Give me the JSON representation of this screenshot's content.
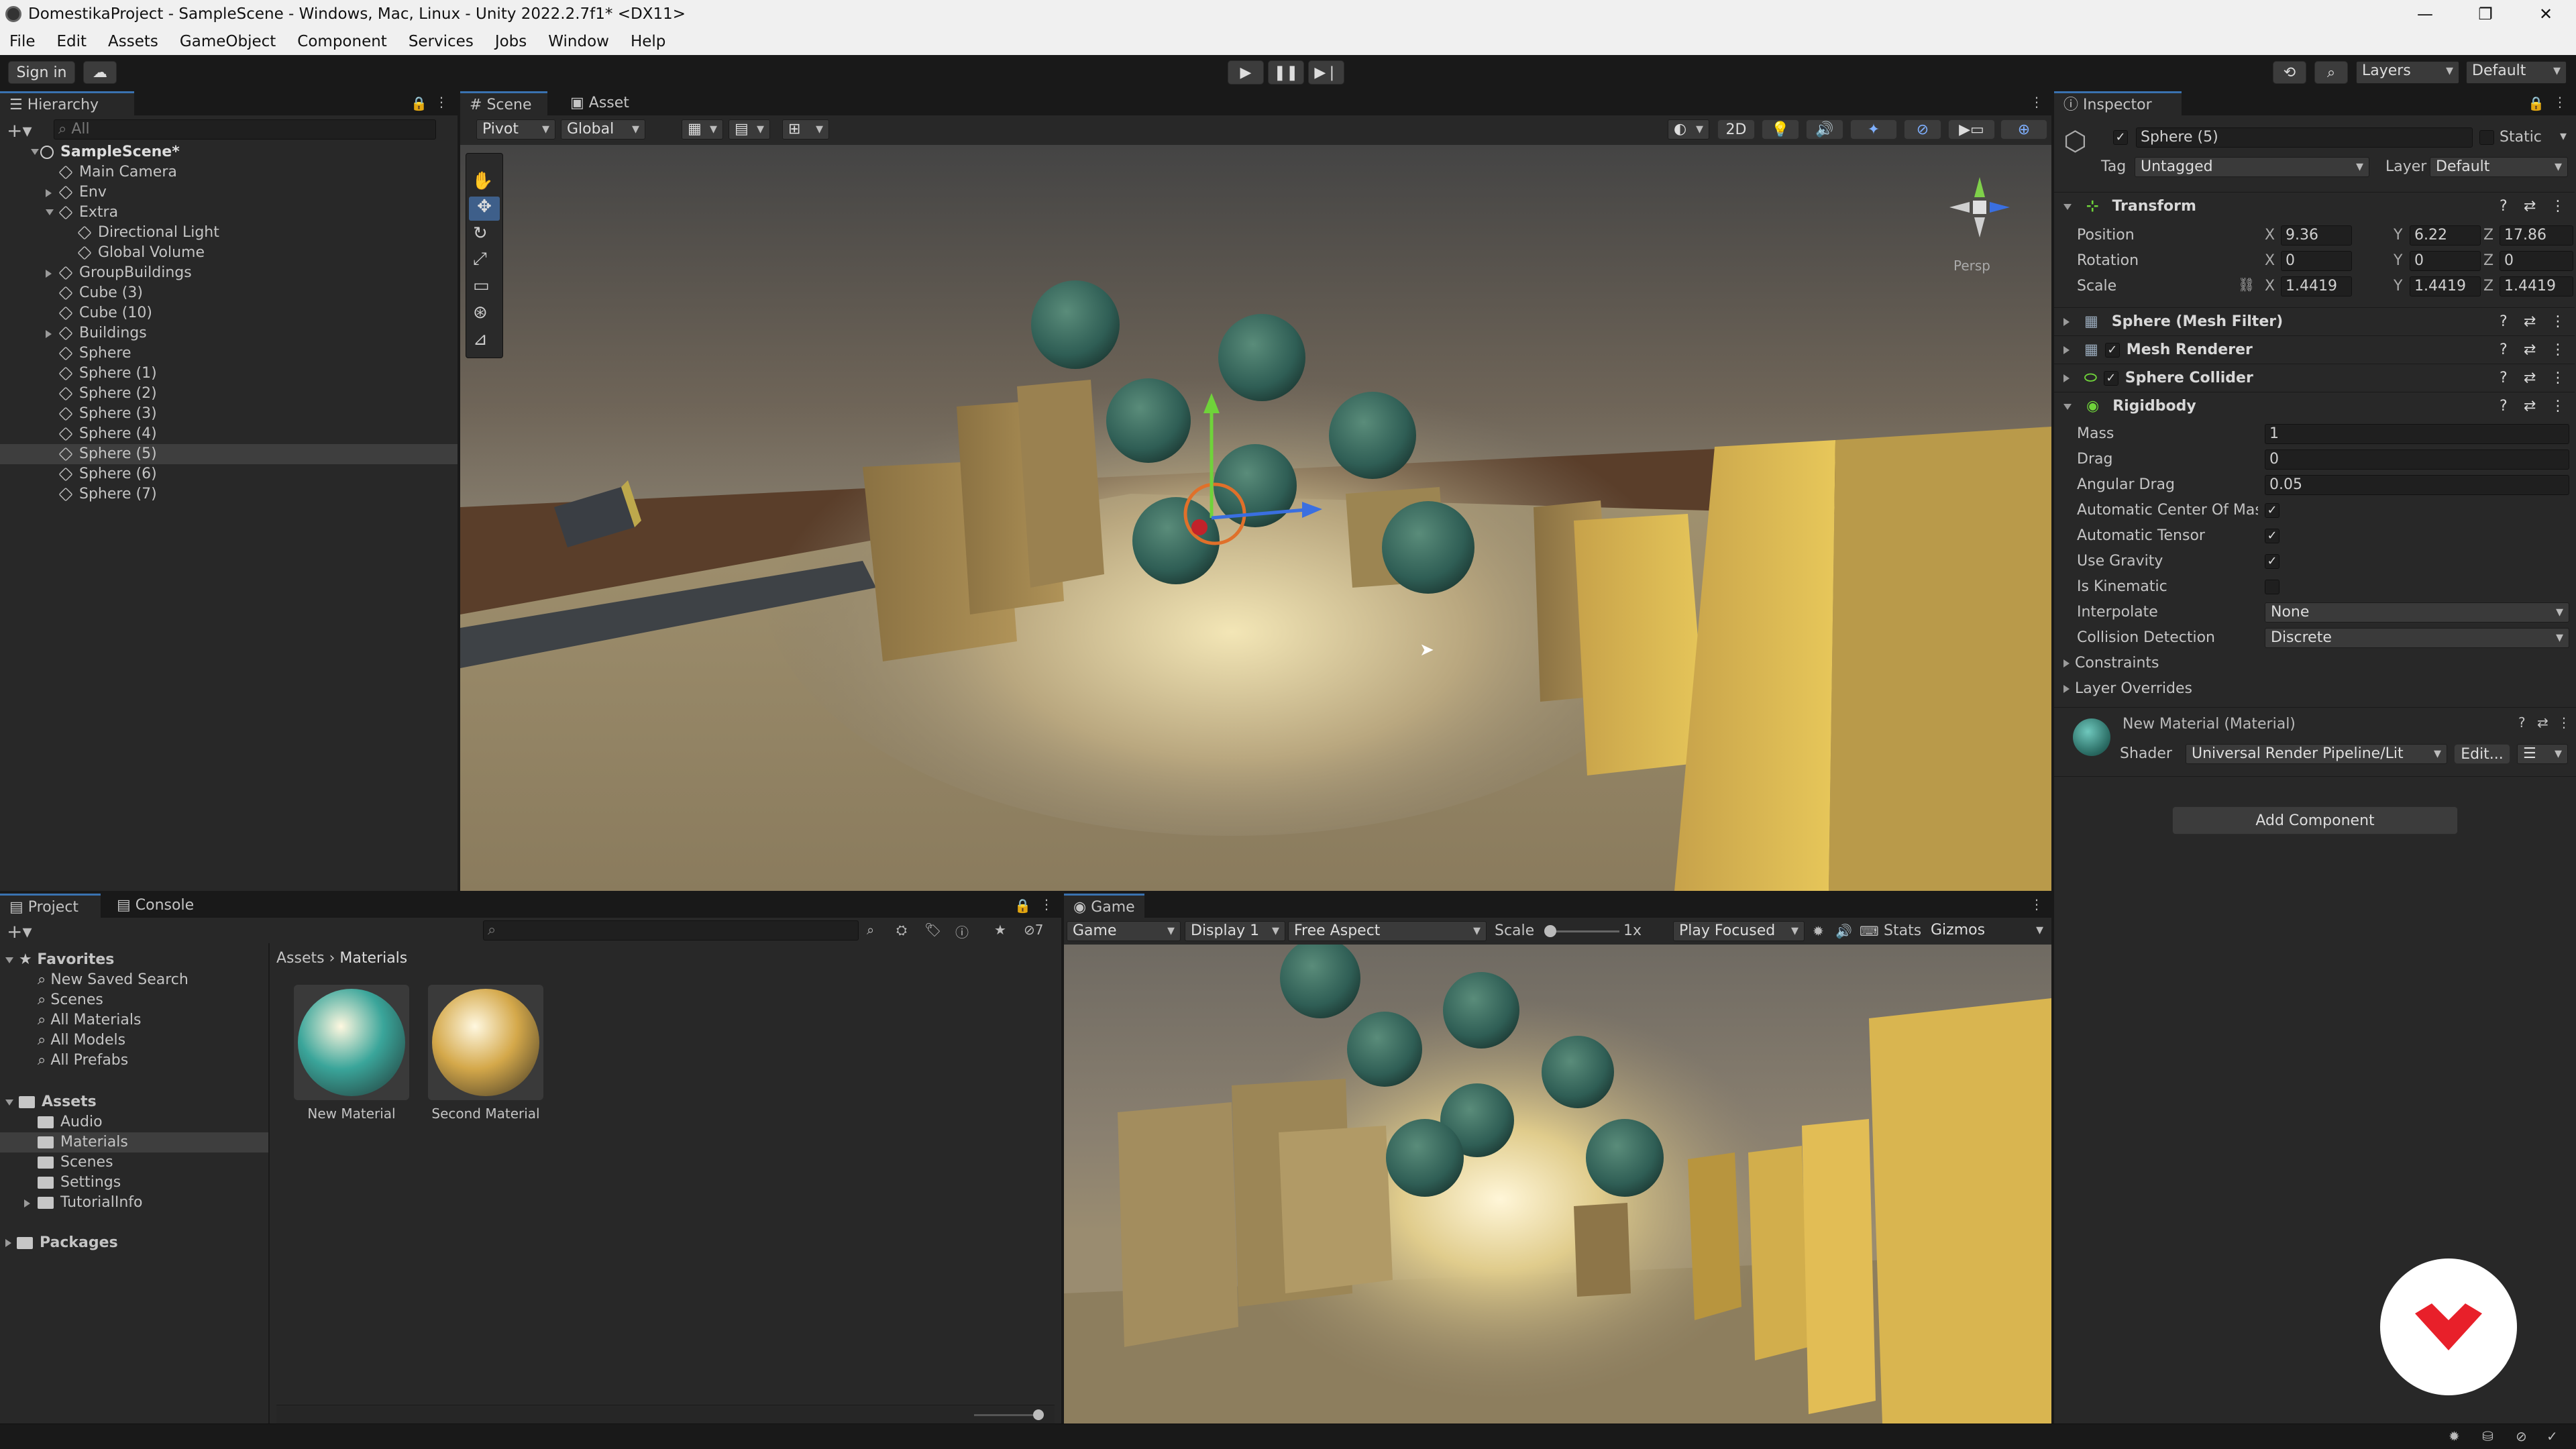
{
  "window": {
    "title": "DomestikaProject - SampleScene - Windows, Mac, Linux - Unity 2022.2.7f1* <DX11>"
  },
  "menu": [
    "File",
    "Edit",
    "Assets",
    "GameObject",
    "Component",
    "Services",
    "Jobs",
    "Window",
    "Help"
  ],
  "toolbar": {
    "sign_in": "Sign in",
    "layers": "Layers",
    "layout": "Default"
  },
  "hierarchy": {
    "title": "Hierarchy",
    "search_placeholder": "All",
    "scene": "SampleScene*",
    "items": [
      {
        "label": "Main Camera",
        "depth": 1,
        "expand": ""
      },
      {
        "label": "Env",
        "depth": 1,
        "expand": "right"
      },
      {
        "label": "Extra",
        "depth": 1,
        "expand": "down"
      },
      {
        "label": "Directional Light",
        "depth": 2,
        "expand": ""
      },
      {
        "label": "Global Volume",
        "depth": 2,
        "expand": ""
      },
      {
        "label": "GroupBuildings",
        "depth": 1,
        "expand": "right"
      },
      {
        "label": "Cube (3)",
        "depth": 1,
        "expand": ""
      },
      {
        "label": "Cube (10)",
        "depth": 1,
        "expand": ""
      },
      {
        "label": "Buildings",
        "depth": 1,
        "expand": "right"
      },
      {
        "label": "Sphere",
        "depth": 1,
        "expand": ""
      },
      {
        "label": "Sphere (1)",
        "depth": 1,
        "expand": ""
      },
      {
        "label": "Sphere (2)",
        "depth": 1,
        "expand": ""
      },
      {
        "label": "Sphere (3)",
        "depth": 1,
        "expand": ""
      },
      {
        "label": "Sphere (4)",
        "depth": 1,
        "expand": ""
      },
      {
        "label": "Sphere (5)",
        "depth": 1,
        "expand": "",
        "selected": true
      },
      {
        "label": "Sphere (6)",
        "depth": 1,
        "expand": ""
      },
      {
        "label": "Sphere (7)",
        "depth": 1,
        "expand": ""
      }
    ]
  },
  "scene_view": {
    "tabs": [
      "Scene",
      "Asset Store"
    ],
    "pivot": "Pivot",
    "global": "Global",
    "mode_2d": "2D",
    "persp": "Persp"
  },
  "inspector": {
    "title": "Inspector",
    "object_name": "Sphere (5)",
    "static_label": "Static",
    "tag_label": "Tag",
    "tag_value": "Untagged",
    "layer_label": "Layer",
    "layer_value": "Default",
    "transform": {
      "title": "Transform",
      "position_label": "Position",
      "rotation_label": "Rotation",
      "scale_label": "Scale",
      "position": {
        "x": "9.36",
        "y": "6.22",
        "z": "17.86"
      },
      "rotation": {
        "x": "0",
        "y": "0",
        "z": "0"
      },
      "scale": {
        "x": "1.4419",
        "y": "1.4419",
        "z": "1.4419"
      }
    },
    "mesh_filter": "Sphere (Mesh Filter)",
    "mesh_renderer": "Mesh Renderer",
    "sphere_collider": "Sphere Collider",
    "rigidbody": {
      "title": "Rigidbody",
      "mass_label": "Mass",
      "mass": "1",
      "drag_label": "Drag",
      "drag": "0",
      "angular_drag_label": "Angular Drag",
      "angular_drag": "0.05",
      "auto_com_label": "Automatic Center Of Mass",
      "auto_tensor_label": "Automatic Tensor",
      "use_gravity_label": "Use Gravity",
      "is_kinematic_label": "Is Kinematic",
      "interpolate_label": "Interpolate",
      "interpolate": "None",
      "collision_label": "Collision Detection",
      "collision": "Discrete",
      "constraints_label": "Constraints",
      "layer_overrides_label": "Layer Overrides"
    },
    "material": {
      "title": "New Material (Material)",
      "shader_label": "Shader",
      "shader": "Universal Render Pipeline/Lit",
      "edit": "Edit..."
    },
    "add_component": "Add Component"
  },
  "project": {
    "tabs": [
      "Project",
      "Console"
    ],
    "favorites_label": "Favorites",
    "favorites": [
      "New Saved Search",
      "Scenes",
      "All Materials",
      "All Models",
      "All Prefabs"
    ],
    "assets_label": "Assets",
    "assets": [
      "Audio",
      "Materials",
      "Scenes",
      "Settings",
      "TutorialInfo"
    ],
    "packages_label": "Packages",
    "breadcrumb": [
      "Assets",
      "Materials"
    ],
    "hidden_count": "7",
    "files": [
      {
        "name": "New Material",
        "color": "#3aa59a"
      },
      {
        "name": "Second Material",
        "color": "#d4a84a"
      }
    ]
  },
  "game_view": {
    "tab": "Game",
    "mode": "Game",
    "display": "Display 1",
    "aspect": "Free Aspect",
    "scale_label": "Scale",
    "scale_value": "1x",
    "play_focused": "Play Focused",
    "stats": "Stats",
    "gizmos": "Gizmos"
  },
  "colors": {
    "accent": "#3a72b0",
    "selected_row": "#3e3e3e",
    "logo": "#e8202a"
  }
}
